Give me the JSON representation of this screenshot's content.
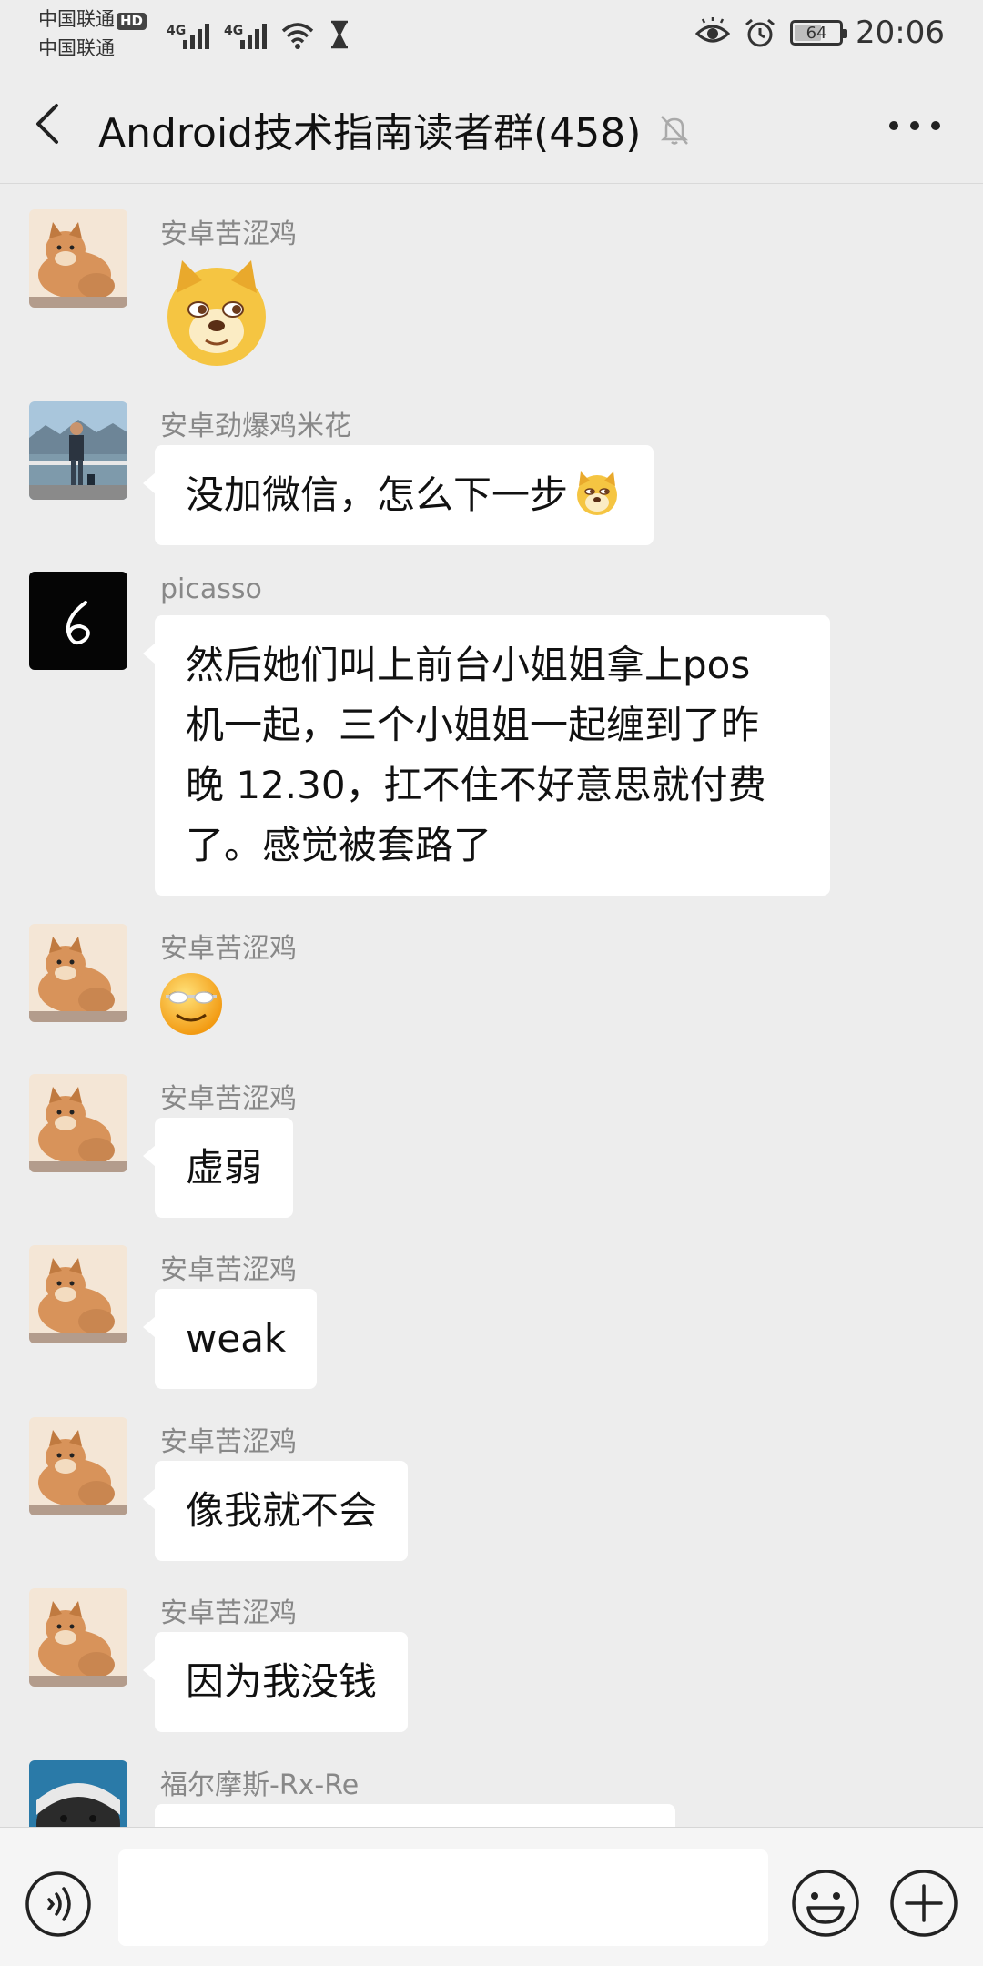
{
  "status_bar": {
    "carrier_1": "中国联通",
    "hd_badge": "HD",
    "carrier_2": "中国联通",
    "network_1": "4G",
    "network_2": "4G",
    "battery_level": 64,
    "battery_text": "64",
    "time": "20:06"
  },
  "header": {
    "title": "Android技术指南读者群(458)",
    "back_icon": "chevron-left-icon",
    "mute_icon": "bell-off-icon",
    "more_icon": "more-dots-icon"
  },
  "messages": [
    {
      "sender": "安卓苦涩鸡",
      "type": "sticker",
      "sticker": "doge-face"
    },
    {
      "sender": "安卓劲爆鸡米花",
      "type": "text",
      "text": "没加微信，怎么下一步"
    },
    {
      "sender": "picasso",
      "type": "text",
      "lines": [
        "然后她们叫上前台小姐姐拿上pos",
        "机一起，三个小姐姐一起缠到了昨",
        "晚 12.30，扛不住不好意思就付费",
        "了。感觉被套路了"
      ]
    },
    {
      "sender": "安卓苦涩鸡",
      "type": "sticker",
      "sticker": "smirk-emoji"
    },
    {
      "sender": "安卓苦涩鸡",
      "type": "text",
      "text": "虚弱"
    },
    {
      "sender": "安卓苦涩鸡",
      "type": "text",
      "text": "weak"
    },
    {
      "sender": "安卓苦涩鸡",
      "type": "text",
      "text": "像我就不会"
    },
    {
      "sender": "安卓苦涩鸡",
      "type": "text",
      "text": "因为我没钱"
    },
    {
      "sender": "福尔摩斯-Rx-Re",
      "type": "text",
      "text": ""
    }
  ],
  "input_bar": {
    "placeholder": "",
    "voice_icon": "voice-icon",
    "emoji_icon": "emoji-icon",
    "plus_icon": "plus-icon"
  },
  "colors": {
    "background": "#ededed",
    "bubble": "#ffffff",
    "sender_text": "#888888"
  }
}
